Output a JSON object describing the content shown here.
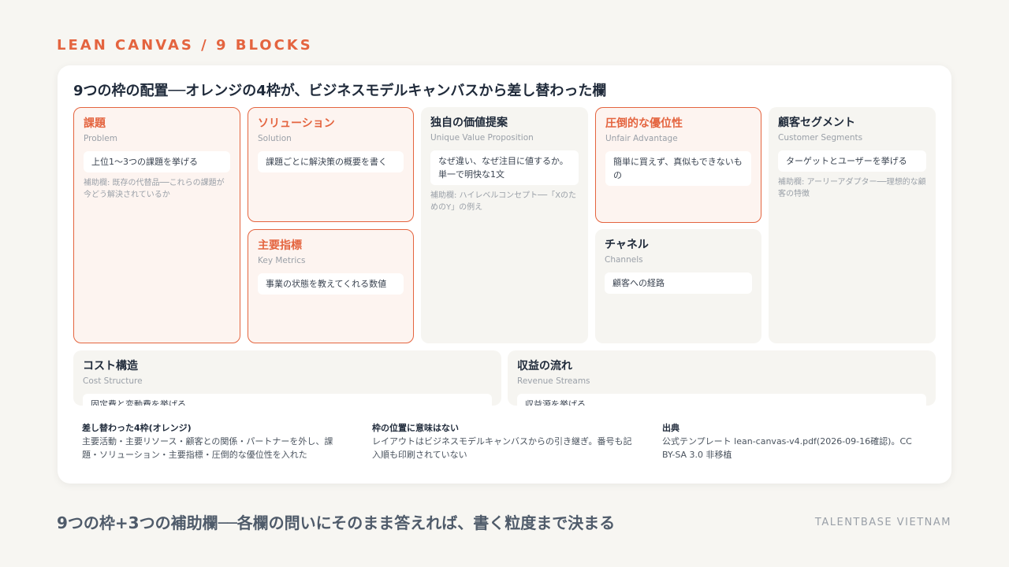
{
  "kicker": "LEAN CANVAS / 9 BLOCKS",
  "card_title": "9つの枠の配置──オレンジの4枠が、ビジネスモデルキャンバスから差し替わった欄",
  "blocks": {
    "problem": {
      "title": "課題",
      "en": "Problem",
      "prompt": "上位1〜3つの課題を挙げる",
      "aux": "補助欄: 既存の代替品──これらの課題が今どう解決されているか"
    },
    "solution": {
      "title": "ソリューション",
      "en": "Solution",
      "prompt": "課題ごとに解決策の概要を書く"
    },
    "key_metrics": {
      "title": "主要指標",
      "en": "Key Metrics",
      "prompt": "事業の状態を教えてくれる数値"
    },
    "uvp": {
      "title": "独自の価値提案",
      "en": "Unique Value Proposition",
      "prompt": "なぜ違い、なぜ注目に値するか。単一で明快な1文",
      "aux": "補助欄: ハイレベルコンセプト──「XのためのY」の例え"
    },
    "unfair_advantage": {
      "title": "圧倒的な優位性",
      "en": "Unfair Advantage",
      "prompt": "簡単に買えず、真似もできないもの"
    },
    "channels": {
      "title": "チャネル",
      "en": "Channels",
      "prompt": "顧客への経路"
    },
    "customer_segments": {
      "title": "顧客セグメント",
      "en": "Customer Segments",
      "prompt": "ターゲットとユーザーを挙げる",
      "aux": "補助欄: アーリーアダプター──理想的な顧客の特徴"
    },
    "cost_structure": {
      "title": "コスト構造",
      "en": "Cost Structure",
      "prompt": "固定費と変動費を挙げる"
    },
    "revenue_streams": {
      "title": "収益の流れ",
      "en": "Revenue Streams",
      "prompt": "収益源を挙げる"
    }
  },
  "notes": [
    {
      "title": "差し替わった4枠(オレンジ)",
      "body": "主要活動・主要リソース・顧客との関係・パートナーを外し、課題・ソリューション・主要指標・圧倒的な優位性を入れた"
    },
    {
      "title": "枠の位置に意味はない",
      "body": "レイアウトはビジネスモデルキャンバスからの引き継ぎ。番号も記入順も印刷されていない"
    },
    {
      "title": "出典",
      "body": "公式テンプレート lean-canvas-v4.pdf(2026-09-16確認)。CC BY-SA 3.0 非移植"
    }
  ],
  "bottom_caption": "9つの枠+3つの補助欄──各欄の問いにそのまま答えれば、書く粒度まで決まる",
  "brand": "TALENTBASE VIETNAM",
  "colors": {
    "accent": "#e4643f",
    "highlight_fill": "#fdf4f0",
    "block_fill": "#f6f5f1",
    "background": "#f7f6f2"
  }
}
